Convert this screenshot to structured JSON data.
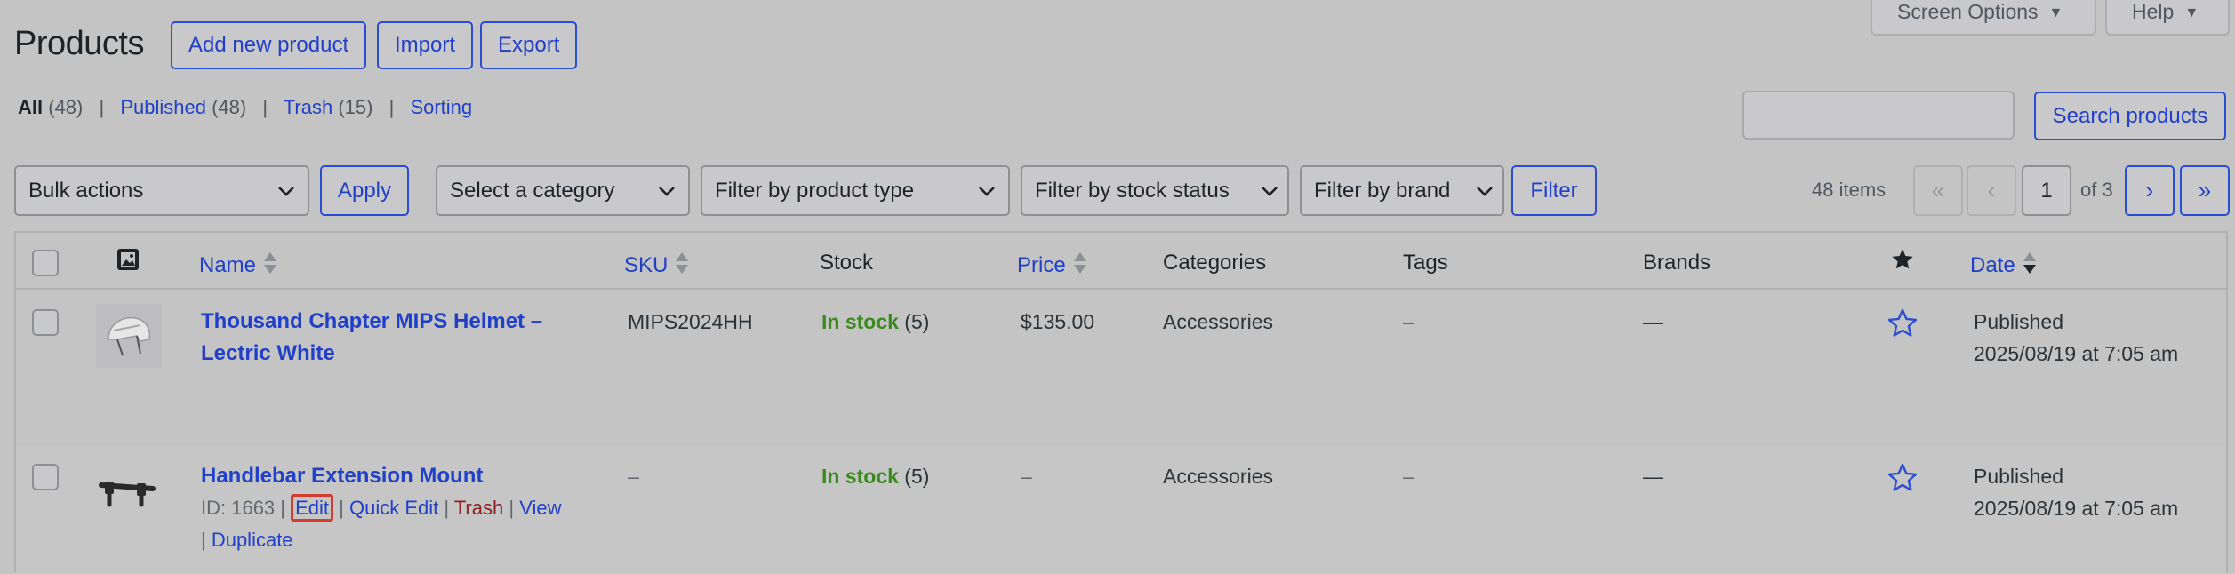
{
  "header": {
    "title": "Products",
    "buttons": {
      "add": "Add new product",
      "import": "Import",
      "export": "Export"
    },
    "screen_options": "Screen Options",
    "help": "Help"
  },
  "views": [
    {
      "label": "All",
      "count": "(48)"
    },
    {
      "label": "Published",
      "count": "(48)"
    },
    {
      "label": "Trash",
      "count": "(15)"
    },
    {
      "label": "Sorting",
      "count": ""
    }
  ],
  "search": {
    "value": "",
    "button": "Search products"
  },
  "filters": {
    "bulk_actions": "Bulk actions",
    "apply": "Apply",
    "category": "Select a category",
    "product_type": "Filter by product type",
    "stock_status": "Filter by stock status",
    "brand": "Filter by brand",
    "filter_button": "Filter"
  },
  "pagination": {
    "items": "48 items",
    "first": "«",
    "prev": "‹",
    "next": "›",
    "last": "»",
    "current": "1",
    "of": "of 3"
  },
  "columns": {
    "name": "Name",
    "sku": "SKU",
    "stock": "Stock",
    "price": "Price",
    "categories": "Categories",
    "tags": "Tags",
    "brands": "Brands",
    "date": "Date"
  },
  "rows": [
    {
      "name_line1": "Thousand Chapter MIPS Helmet –",
      "name_line2": "Lectric White",
      "sku": "MIPS2024HH",
      "stock_status": "In stock",
      "stock_qty": " (5)",
      "price": "$135.00",
      "category": "Accessories",
      "tags": "–",
      "brands": "—",
      "date_status": "Published",
      "date_value": "2025/08/19 at 7:05 am"
    },
    {
      "name_line1": "Handlebar Extension Mount",
      "sku": "–",
      "stock_status": "In stock",
      "stock_qty": " (5)",
      "price": "–",
      "category": "Accessories",
      "tags": "–",
      "brands": "—",
      "date_status": "Published",
      "date_value": "2025/08/19 at 7:05 am",
      "row_actions": {
        "id": "ID: 1663",
        "edit": "Edit",
        "quick_edit": "Quick Edit",
        "trash": "Trash",
        "view": "View",
        "duplicate": "Duplicate"
      }
    }
  ],
  "colors": {
    "link": "#2040c8",
    "in_stock": "#3b8a1e",
    "trash": "#8a2020",
    "highlight": "#d63b2f"
  }
}
